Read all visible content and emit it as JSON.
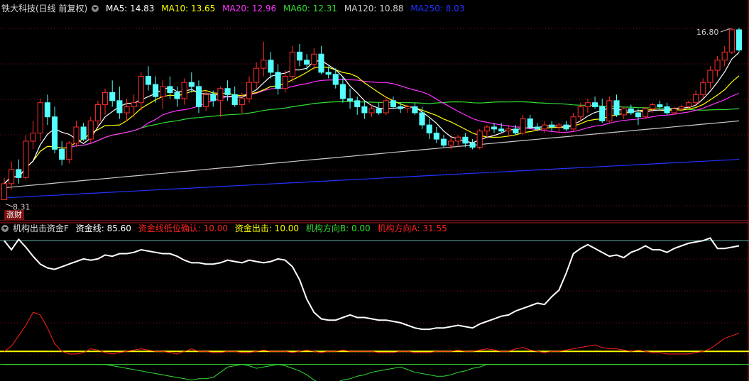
{
  "header": {
    "title": "铁大科技(日线 前复权)",
    "ma": [
      {
        "label": "MA5: 14.83",
        "color": "#ffffff"
      },
      {
        "label": "MA10: 13.65",
        "color": "#ffff00"
      },
      {
        "label": "MA20: 12.96",
        "color": "#ff33ff"
      },
      {
        "label": "MA60: 12.31",
        "color": "#33dd33"
      },
      {
        "label": "MA120: 10.88",
        "color": "#cccccc"
      },
      {
        "label": "MA250: 8.03",
        "color": "#2233ff"
      }
    ]
  },
  "indicator": {
    "title": "机构出击资金F",
    "items": [
      {
        "label": "资金线: 85.60",
        "color": "#ffffff"
      },
      {
        "label": "资金线低位确认: 10.00",
        "color": "#ff2020"
      },
      {
        "label": "资金出击: 10.00",
        "color": "#ffff00"
      },
      {
        "label": "机构方向B: 0.00",
        "color": "#33dd33"
      },
      {
        "label": "机构方向A: 31.55",
        "color": "#ff2020"
      }
    ]
  },
  "badge": "涨财",
  "chart_data": {
    "type": "candlestick",
    "high_label": "16.80",
    "low_label": "8.31",
    "price_range": [
      7.8,
      17.4
    ],
    "up_color": "#ff2d2d",
    "down_color": "#54ffff",
    "candles": [
      [
        8.31,
        9.4,
        8.31,
        9.1
      ],
      [
        9.1,
        10.2,
        8.8,
        9.8
      ],
      [
        9.8,
        10.3,
        9.1,
        9.4
      ],
      [
        9.4,
        11.5,
        9.3,
        11.2
      ],
      [
        11.2,
        12.2,
        10.8,
        11.6
      ],
      [
        11.6,
        13.3,
        11.2,
        13.1
      ],
      [
        13.1,
        13.5,
        12.0,
        12.4
      ],
      [
        12.4,
        12.9,
        10.6,
        10.8
      ],
      [
        10.8,
        11.2,
        10.0,
        10.3
      ],
      [
        10.3,
        11.2,
        10.1,
        11.1
      ],
      [
        11.1,
        12.2,
        10.9,
        11.9
      ],
      [
        11.9,
        12.1,
        11.2,
        11.3
      ],
      [
        11.3,
        12.4,
        11.1,
        12.2
      ],
      [
        12.2,
        13.2,
        11.9,
        13.0
      ],
      [
        13.0,
        13.8,
        12.5,
        13.6
      ],
      [
        13.6,
        14.2,
        12.9,
        13.2
      ],
      [
        13.2,
        13.9,
        12.3,
        12.6
      ],
      [
        12.6,
        13.3,
        12.2,
        12.9
      ],
      [
        12.9,
        13.5,
        12.4,
        13.1
      ],
      [
        13.1,
        14.6,
        12.7,
        14.4
      ],
      [
        14.4,
        14.9,
        13.7,
        14.0
      ],
      [
        14.0,
        14.4,
        13.1,
        13.4
      ],
      [
        13.4,
        14.2,
        12.8,
        13.9
      ],
      [
        13.9,
        14.4,
        13.3,
        13.6
      ],
      [
        13.6,
        13.9,
        12.9,
        13.3
      ],
      [
        13.3,
        14.3,
        13.0,
        14.1
      ],
      [
        14.1,
        14.6,
        13.6,
        13.9
      ],
      [
        13.9,
        14.2,
        12.6,
        12.9
      ],
      [
        12.9,
        13.7,
        12.7,
        13.5
      ],
      [
        13.5,
        13.7,
        12.9,
        13.2
      ],
      [
        13.2,
        13.9,
        12.4,
        13.8
      ],
      [
        13.8,
        14.2,
        13.2,
        13.5
      ],
      [
        13.5,
        13.9,
        12.9,
        13.0
      ],
      [
        13.0,
        13.6,
        12.6,
        13.3
      ],
      [
        13.3,
        14.4,
        13.1,
        14.1
      ],
      [
        14.1,
        15.1,
        13.8,
        14.8
      ],
      [
        14.8,
        16.1,
        14.4,
        15.2
      ],
      [
        15.2,
        15.6,
        14.3,
        14.6
      ],
      [
        14.6,
        15.0,
        13.5,
        13.8
      ],
      [
        13.8,
        14.7,
        13.6,
        14.4
      ],
      [
        14.4,
        15.9,
        14.1,
        15.6
      ],
      [
        15.6,
        16.0,
        14.9,
        15.2
      ],
      [
        15.2,
        15.5,
        14.7,
        15.0
      ],
      [
        15.0,
        15.8,
        14.7,
        15.5
      ],
      [
        15.5,
        15.9,
        14.5,
        14.6
      ],
      [
        14.6,
        14.9,
        14.3,
        14.5
      ],
      [
        14.5,
        14.8,
        13.8,
        14.0
      ],
      [
        14.0,
        14.4,
        13.1,
        13.3
      ],
      [
        13.3,
        13.8,
        12.8,
        13.2
      ],
      [
        13.2,
        13.4,
        12.5,
        12.9
      ],
      [
        12.9,
        13.2,
        12.3,
        12.6
      ],
      [
        12.6,
        13.0,
        12.4,
        12.8
      ],
      [
        12.8,
        13.1,
        12.5,
        12.6
      ],
      [
        12.6,
        13.4,
        12.5,
        13.2
      ],
      [
        13.2,
        13.4,
        12.8,
        12.9
      ],
      [
        12.9,
        13.1,
        12.6,
        12.8
      ],
      [
        12.8,
        13.0,
        12.6,
        12.9
      ],
      [
        12.9,
        13.1,
        12.5,
        12.6
      ],
      [
        12.6,
        12.9,
        11.8,
        12.0
      ],
      [
        12.0,
        12.3,
        11.3,
        11.6
      ],
      [
        11.6,
        11.9,
        11.1,
        11.3
      ],
      [
        11.3,
        11.5,
        10.9,
        11.0
      ],
      [
        11.0,
        11.4,
        10.8,
        11.2
      ],
      [
        11.2,
        11.5,
        10.9,
        11.4
      ],
      [
        11.4,
        11.6,
        10.9,
        11.1
      ],
      [
        11.1,
        11.3,
        10.8,
        10.9
      ],
      [
        10.9,
        11.8,
        10.8,
        11.7
      ],
      [
        11.7,
        12.0,
        11.4,
        11.9
      ],
      [
        11.9,
        12.1,
        11.6,
        11.8
      ],
      [
        11.8,
        12.1,
        11.6,
        11.7
      ],
      [
        11.7,
        12.0,
        11.4,
        11.8
      ],
      [
        11.8,
        12.0,
        11.5,
        11.6
      ],
      [
        11.6,
        12.5,
        11.5,
        12.3
      ],
      [
        12.3,
        12.5,
        11.8,
        11.9
      ],
      [
        11.9,
        12.1,
        11.7,
        11.8
      ],
      [
        11.8,
        12.2,
        11.6,
        12.0
      ],
      [
        12.0,
        12.2,
        11.7,
        11.9
      ],
      [
        11.9,
        12.1,
        11.6,
        12.0
      ],
      [
        12.0,
        12.2,
        11.7,
        11.8
      ],
      [
        11.8,
        12.6,
        11.7,
        12.4
      ],
      [
        12.4,
        13.1,
        12.2,
        12.9
      ],
      [
        12.9,
        13.3,
        12.6,
        13.1
      ],
      [
        13.1,
        13.4,
        12.8,
        12.9
      ],
      [
        12.9,
        13.3,
        12.1,
        12.2
      ],
      [
        12.2,
        13.4,
        12.1,
        13.2
      ],
      [
        13.2,
        13.5,
        12.4,
        12.5
      ],
      [
        12.5,
        12.9,
        12.3,
        12.8
      ],
      [
        12.8,
        13.0,
        12.5,
        12.6
      ],
      [
        12.6,
        12.8,
        12.0,
        12.4
      ],
      [
        12.4,
        12.9,
        12.3,
        12.8
      ],
      [
        12.8,
        13.1,
        12.6,
        13.0
      ],
      [
        13.0,
        13.2,
        12.8,
        12.9
      ],
      [
        12.9,
        13.1,
        12.5,
        12.6
      ],
      [
        12.6,
        12.9,
        12.5,
        12.8
      ],
      [
        12.8,
        13.0,
        12.7,
        12.9
      ],
      [
        12.9,
        13.2,
        12.8,
        13.1
      ],
      [
        13.1,
        13.7,
        12.9,
        13.5
      ],
      [
        13.5,
        14.3,
        13.3,
        14.1
      ],
      [
        14.1,
        14.9,
        13.8,
        14.7
      ],
      [
        14.7,
        15.4,
        14.4,
        15.2
      ],
      [
        15.2,
        15.9,
        14.9,
        15.6
      ],
      [
        15.6,
        16.8,
        15.5,
        16.7
      ],
      [
        16.7,
        16.8,
        15.6,
        15.7
      ]
    ],
    "ma250": {
      "start": 8.4,
      "end": 10.3
    },
    "ma120": {
      "start": 8.9,
      "end": 12.2
    },
    "indicator_range": [
      -10,
      100
    ],
    "money_line": [
      95,
      88,
      96,
      90,
      83,
      77,
      74,
      73,
      75,
      77,
      79,
      81,
      80,
      81,
      84,
      83,
      85,
      85,
      86,
      88,
      87,
      86,
      85,
      85,
      83,
      80,
      78,
      78,
      77,
      77,
      78,
      80,
      79,
      78,
      80,
      79,
      78,
      79,
      81,
      80,
      75,
      65,
      50,
      40,
      35,
      34,
      34,
      36,
      38,
      36,
      36,
      35,
      34,
      34,
      33,
      32,
      30,
      28,
      27,
      27,
      28,
      28,
      29,
      30,
      29,
      28,
      31,
      33,
      35,
      37,
      38,
      41,
      43,
      45,
      47,
      46,
      52,
      57,
      70,
      85,
      89,
      92,
      89,
      86,
      83,
      84,
      82,
      86,
      88,
      91,
      88,
      88,
      86,
      89,
      91,
      93,
      94,
      95,
      97,
      89,
      89,
      90,
      91
    ],
    "fund_confirm": [
      10,
      14,
      22,
      30,
      40,
      38,
      28,
      16,
      10,
      8,
      8,
      9,
      12,
      11,
      9,
      8,
      9,
      10,
      11,
      12,
      11,
      10,
      10,
      9,
      8,
      10,
      12,
      10,
      10,
      9,
      9,
      10,
      10,
      9,
      9,
      10,
      11,
      10,
      10,
      10,
      9,
      10,
      11,
      10,
      9,
      10,
      10,
      11,
      10,
      10,
      10,
      10,
      9,
      9,
      9,
      10,
      10,
      9,
      9,
      9,
      10,
      10,
      10,
      11,
      10,
      10,
      11,
      12,
      11,
      10,
      10,
      12,
      13,
      11,
      10,
      9,
      10,
      10,
      11,
      12,
      13,
      14,
      15,
      13,
      12,
      12,
      11,
      10,
      11,
      10,
      9,
      9,
      8,
      8,
      8,
      8,
      9,
      10,
      12,
      16,
      20,
      22,
      24
    ],
    "inst_b": [
      0,
      0,
      0,
      0,
      0,
      0,
      0,
      0,
      0,
      0,
      0,
      0,
      0,
      0,
      0,
      -1,
      -2,
      -3,
      -4,
      -5,
      -6,
      -7,
      -8,
      -9,
      -10,
      -11,
      -12,
      -11,
      -11,
      -10,
      -6,
      -2,
      -1,
      0,
      -1,
      -3,
      -2,
      -1,
      0,
      -1,
      -3,
      -5,
      -8,
      -12,
      -15,
      -17,
      -14,
      -12,
      -11,
      -9,
      -8,
      -6,
      -5,
      -4,
      -3,
      -2,
      -4,
      -6,
      -7,
      -8,
      -9,
      -9,
      -8,
      -6,
      -5,
      -3,
      -2,
      0,
      0,
      0,
      0,
      0,
      0,
      0,
      0,
      0,
      0,
      0,
      0,
      0,
      0,
      0,
      0,
      0,
      0,
      0,
      0,
      0,
      0,
      0,
      0,
      0,
      0,
      0,
      0,
      0,
      0,
      0,
      0,
      0,
      0,
      0,
      0
    ],
    "fund_strike": 10,
    "upper_level": 95
  }
}
